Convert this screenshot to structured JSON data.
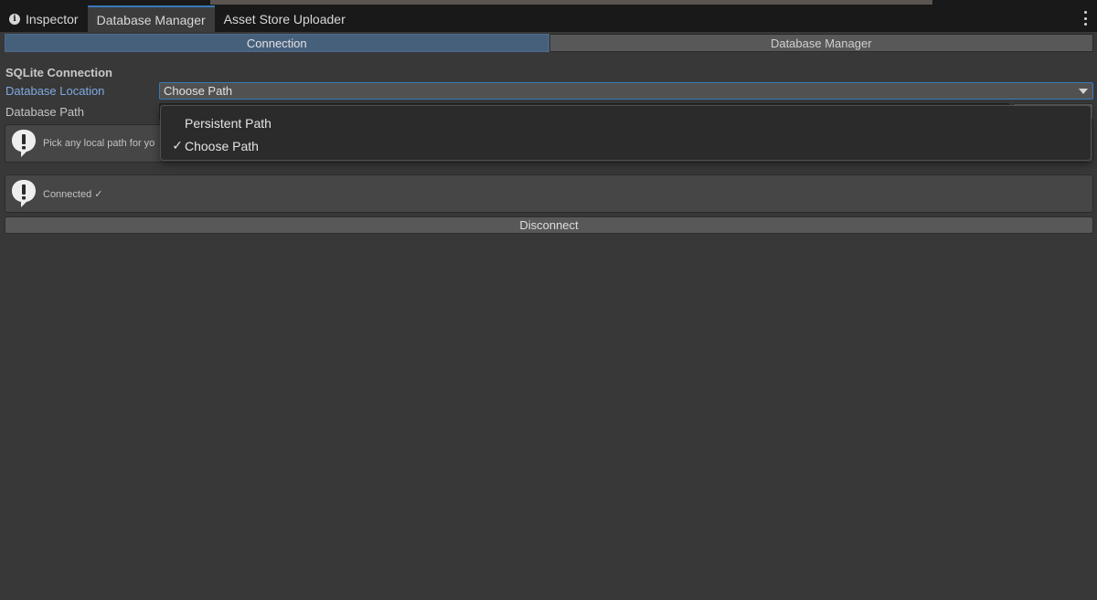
{
  "tabs": [
    {
      "label": "Inspector",
      "icon": "info-icon",
      "active": false
    },
    {
      "label": "Database Manager",
      "active": true
    },
    {
      "label": "Asset Store Uploader",
      "active": false
    }
  ],
  "toolbar": {
    "connection_label": "Connection",
    "database_manager_label": "Database Manager",
    "selected": "Connection"
  },
  "section": {
    "title": "SQLite Connection"
  },
  "fields": {
    "location_label": "Database Location",
    "location_value": "Choose Path",
    "path_label": "Database Path"
  },
  "helpbox_path": {
    "icon": "warning-icon",
    "text": "Pick any local path for yo"
  },
  "helpbox_status": {
    "icon": "warning-icon",
    "text": "Connected ✓"
  },
  "buttons": {
    "disconnect_label": "Disconnect"
  },
  "dropdown_menu": {
    "items": [
      {
        "label": "Persistent Path",
        "checked": false
      },
      {
        "label": "Choose Path",
        "checked": true
      }
    ],
    "check_glyph": "✓"
  },
  "colors": {
    "accent": "#3a79bb",
    "selected_tab": "#46607c",
    "focused_label": "#7fa8e0",
    "background": "#383838"
  }
}
